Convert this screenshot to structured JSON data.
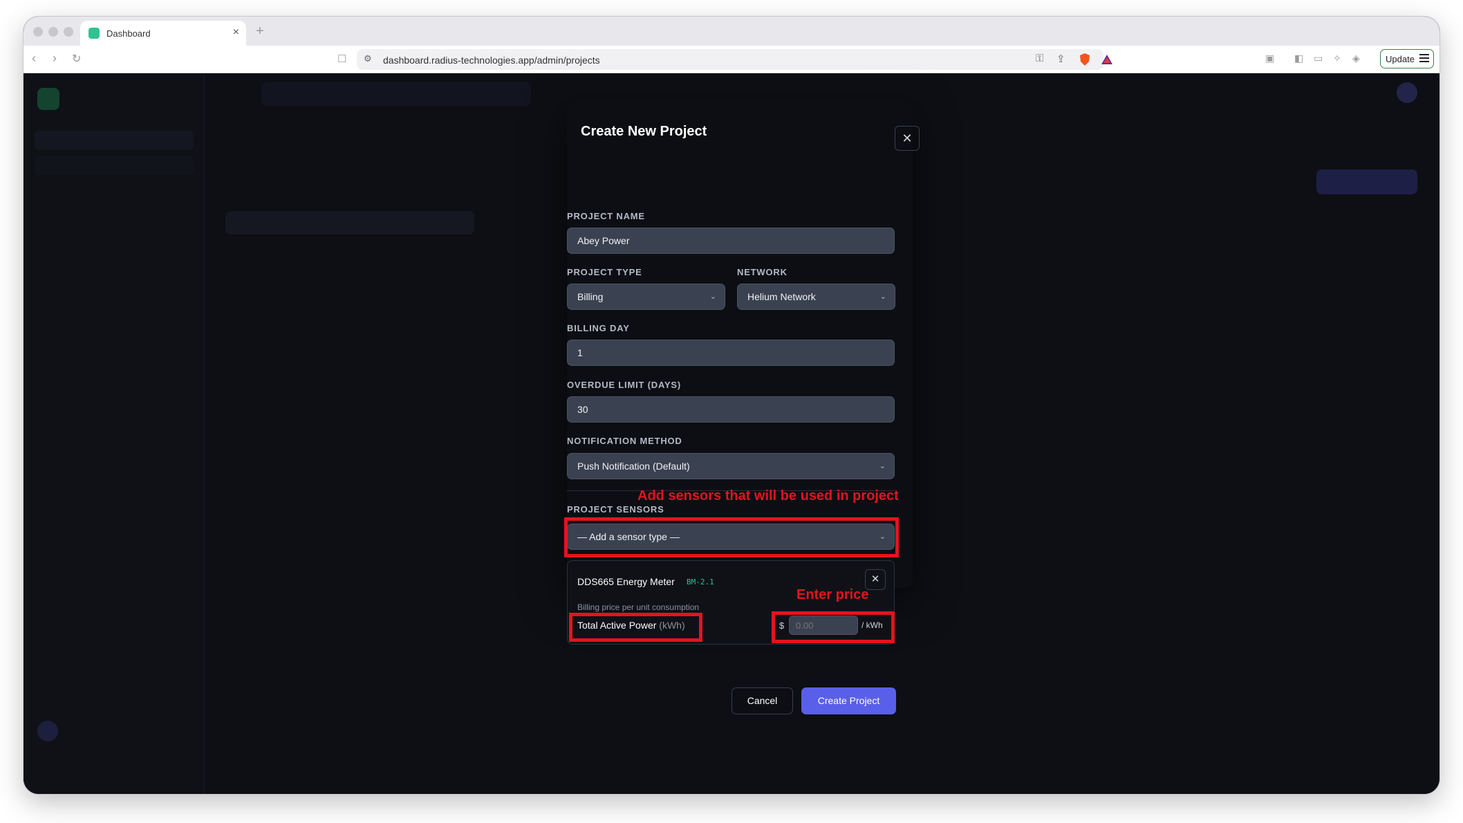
{
  "browser": {
    "tab_title": "Dashboard",
    "url": "dashboard.radius-technologies.app/admin/projects",
    "update_label": "Update"
  },
  "modal": {
    "title": "Create New Project",
    "project_name": {
      "label": "PROJECT NAME",
      "value": "Abey Power"
    },
    "project_type": {
      "label": "PROJECT TYPE",
      "value": "Billing"
    },
    "network": {
      "label": "NETWORK",
      "value": "Helium Network"
    },
    "billing_day": {
      "label": "BILLING DAY",
      "value": "1"
    },
    "overdue_limit": {
      "label": "OVERDUE LIMIT (DAYS)",
      "value": "30"
    },
    "notification_method": {
      "label": "NOTIFICATION METHOD",
      "value": "Push Notification (Default)"
    },
    "project_sensors": {
      "label": "PROJECT SENSORS",
      "placeholder": "— Add a sensor type —"
    },
    "sensor": {
      "name": "DDS665 Energy Meter",
      "code": "BM-2.1",
      "hint": "Billing price per unit consumption",
      "metric": "Total Active Power",
      "metric_unit": "(kWh)",
      "currency": "$",
      "price_placeholder": "0.00",
      "per_unit": "/ kWh"
    },
    "cancel_label": "Cancel",
    "create_label": "Create Project"
  },
  "annotations": {
    "sensors_note": "Add sensors that will be used in project",
    "price_note": "Enter price",
    "color": "#e3141f"
  }
}
